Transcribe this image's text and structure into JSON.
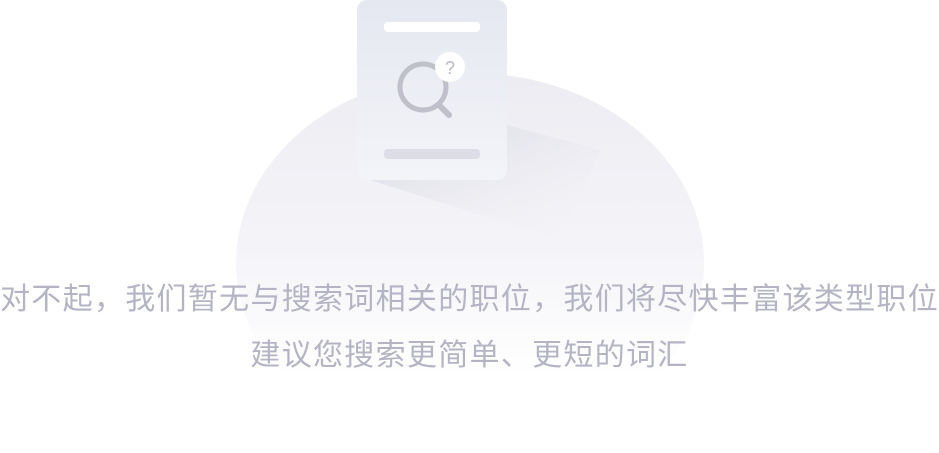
{
  "empty_state": {
    "illustration": "search-no-result-icon",
    "message_line1": "对不起，我们暂无与搜索词相关的职位，我们将尽快丰富该类型职位",
    "message_line2": "建议您搜索更简单、更短的词汇"
  },
  "colors": {
    "text": "#b4b4c4",
    "background": "#ffffff"
  }
}
